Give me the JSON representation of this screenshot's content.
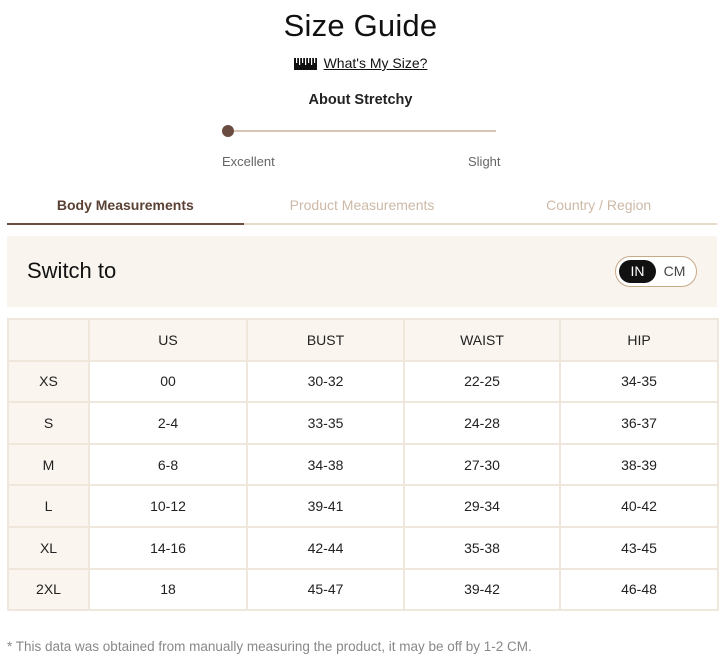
{
  "title": "Size Guide",
  "size_link": {
    "label": "What's My Size?",
    "icon": "ruler-icon"
  },
  "stretch": {
    "title": "About Stretchy",
    "low_label": "Excellent",
    "high_label": "Slight",
    "level": 0
  },
  "tabs": [
    {
      "label": "Body Measurements",
      "active": true
    },
    {
      "label": "Product Measurements",
      "active": false
    },
    {
      "label": "Country / Region",
      "active": false
    }
  ],
  "unit_switch": {
    "label": "Switch to",
    "options": [
      "IN",
      "CM"
    ],
    "selected": "IN"
  },
  "table": {
    "headers": [
      "",
      "US",
      "BUST",
      "WAIST",
      "HIP"
    ],
    "rows": [
      [
        "XS",
        "00",
        "30-32",
        "22-25",
        "34-35"
      ],
      [
        "S",
        "2-4",
        "33-35",
        "24-28",
        "36-37"
      ],
      [
        "M",
        "6-8",
        "34-38",
        "27-30",
        "38-39"
      ],
      [
        "L",
        "10-12",
        "39-41",
        "29-34",
        "40-42"
      ],
      [
        "XL",
        "14-16",
        "42-44",
        "35-38",
        "43-45"
      ],
      [
        "2XL",
        "18",
        "45-47",
        "39-42",
        "46-48"
      ]
    ]
  },
  "footnote": "* This data was obtained from manually measuring the product, it may be off by 1-2 CM.",
  "colors": {
    "accent": "#6b4c40",
    "track": "#d7c6b6",
    "panel": "#f9f4ee",
    "inactive_tab": "#cdb9a7"
  }
}
